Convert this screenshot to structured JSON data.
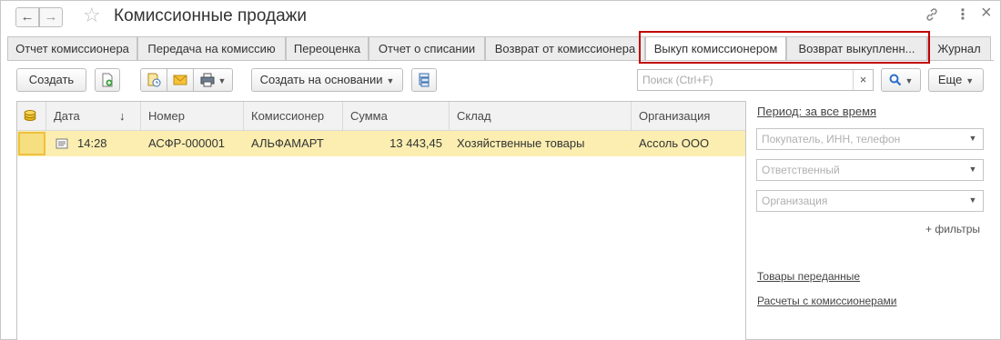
{
  "window": {
    "title": "Комиссионные продажи",
    "nav_back": "←",
    "nav_forward": "→",
    "star": "☆",
    "icons": {
      "link": "🔗",
      "menu": "⋮",
      "close": "×"
    }
  },
  "tabs": [
    {
      "label": "Отчет комиссионера",
      "active": false
    },
    {
      "label": "Передача на комиссию",
      "active": false
    },
    {
      "label": "Переоценка",
      "active": false
    },
    {
      "label": "Отчет о списании",
      "active": false
    },
    {
      "label": "Возврат от комиссионера",
      "active": false
    },
    {
      "label": "Выкуп комиссионером",
      "active": true
    },
    {
      "label": "Возврат выкупленн...",
      "active": false
    },
    {
      "label": "Журнал",
      "active": false
    }
  ],
  "toolbar": {
    "create_label": "Создать",
    "create_based_label": "Создать на основании",
    "more_label": "Еще",
    "search_placeholder": "Поиск (Ctrl+F)",
    "search_clear": "×"
  },
  "table": {
    "columns": [
      "Дата",
      "Номер",
      "Комиссионер",
      "Сумма",
      "Склад",
      "Организация"
    ],
    "sort_indicator": "↓",
    "rows": [
      {
        "date": "14:28",
        "number": "АСФР-000001",
        "commissioner": "АЛЬФАМАРТ",
        "sum": "13 443,45",
        "warehouse": "Хозяйственные товары",
        "organization": "Ассоль ООО"
      }
    ]
  },
  "side": {
    "period": "Период: за все время",
    "filters": [
      "Покупатель, ИНН, телефон",
      "Ответственный",
      "Организация"
    ],
    "more_filters": "+ фильтры",
    "links": [
      "Товары переданные",
      "Расчеты с комиссионерами"
    ]
  },
  "colors": {
    "selected_row": "#fbeeb0",
    "highlight_border": "#c00000",
    "search_icon": "#2a6fc9"
  }
}
